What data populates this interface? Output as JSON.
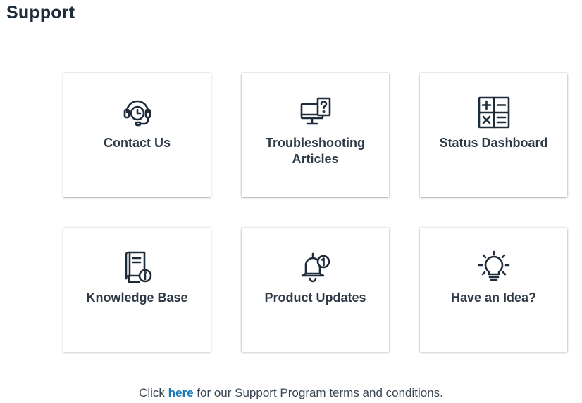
{
  "page": {
    "title": "Support"
  },
  "cards": [
    {
      "label": "Contact Us",
      "icon": "headset-clock-icon"
    },
    {
      "label": "Troubleshooting Articles",
      "icon": "monitor-question-icon"
    },
    {
      "label": "Status Dashboard",
      "icon": "calculator-icon"
    },
    {
      "label": "Knowledge Base",
      "icon": "book-info-icon"
    },
    {
      "label": "Product Updates",
      "icon": "bell-notification-icon"
    },
    {
      "label": "Have an Idea?",
      "icon": "lightbulb-icon"
    }
  ],
  "footer": {
    "prefix": "Click ",
    "link_text": "here",
    "suffix": " for our Support Program terms and conditions."
  },
  "colors": {
    "text": "#1d2b3a",
    "link": "#1a7ab8",
    "icon": "#1d2b3a"
  }
}
